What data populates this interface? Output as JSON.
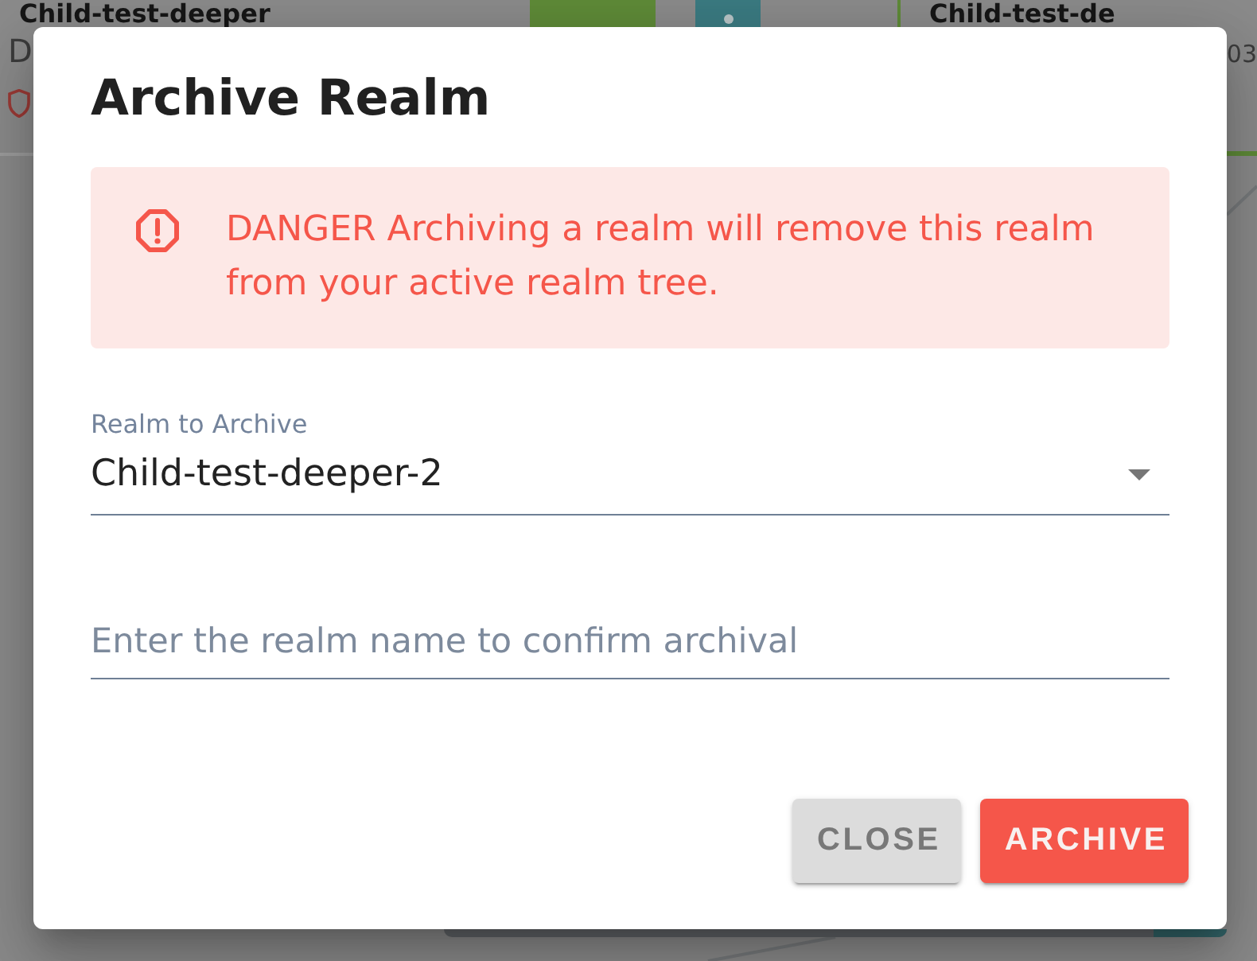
{
  "background": {
    "left_card": {
      "title": "Child-test-deeper",
      "subtitle": "D"
    },
    "right_card": {
      "title": "Child-test-de",
      "subtitle": "03"
    }
  },
  "dialog": {
    "title": "Archive Realm",
    "alert": {
      "kind": "danger",
      "text": "DANGER Archiving a realm will remove this realm from your active realm tree."
    },
    "fields": [
      {
        "kind": "select",
        "label": "Realm to Archive",
        "value": "Child-test-deeper-2"
      },
      {
        "kind": "text",
        "placeholder": "Enter the realm name to confirm archival"
      }
    ],
    "buttons": [
      {
        "label": "CLOSE",
        "kind": "secondary"
      },
      {
        "label": "ARCHIVE",
        "kind": "primary"
      }
    ]
  }
}
